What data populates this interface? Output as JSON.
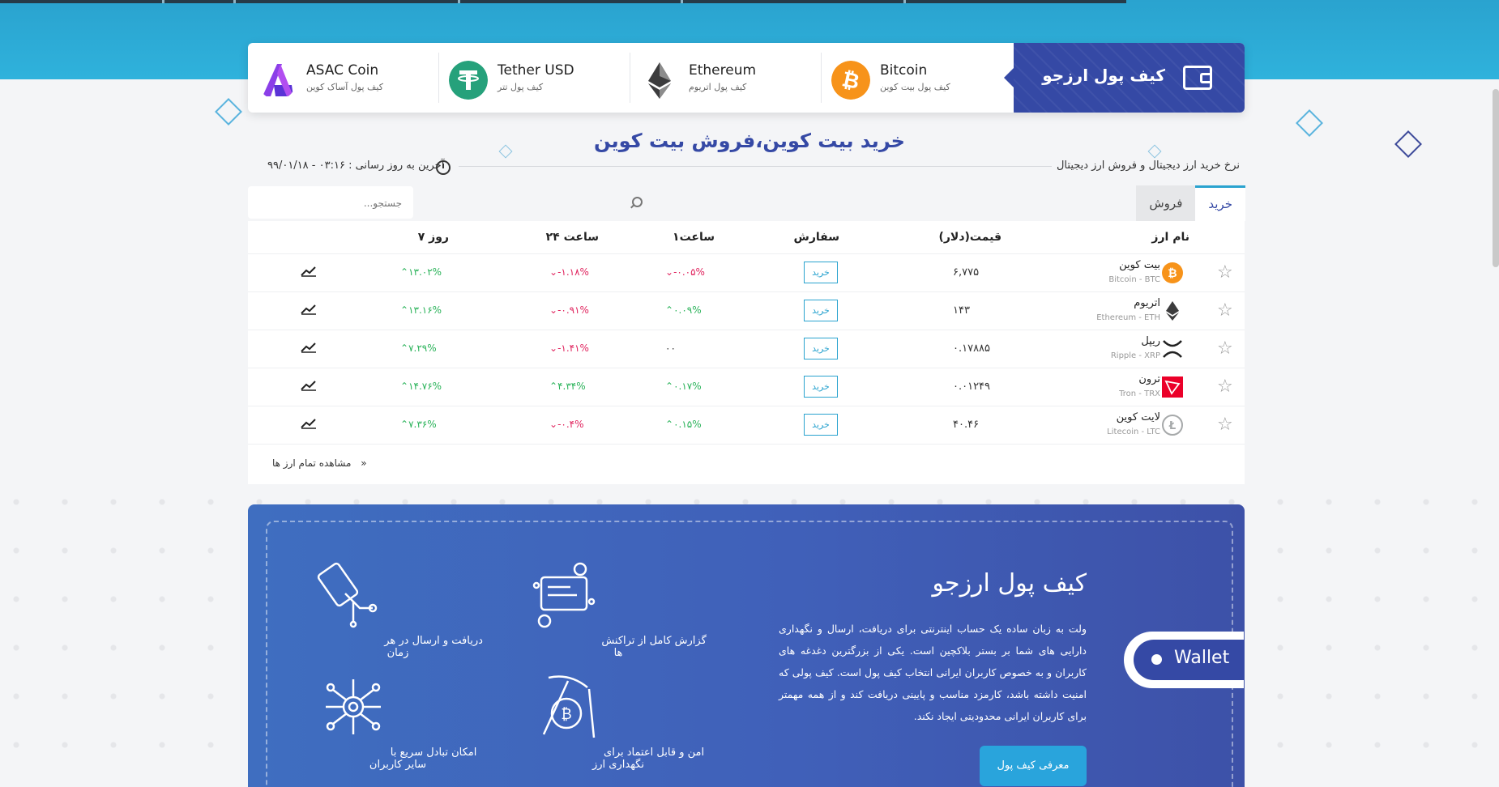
{
  "wallet_bar": {
    "title": "کیف پول ارزجو",
    "coins": [
      {
        "name": "Bitcoin",
        "sub": "کیف پول بیت کوین",
        "color": "#f7931a",
        "icon": "bitcoin-icon"
      },
      {
        "name": "Ethereum",
        "sub": "کیف پول اتریوم",
        "color": "#3c3c3d",
        "icon": "ethereum-icon"
      },
      {
        "name": "Tether USD",
        "sub": "کیف پول تتر",
        "color": "#26a17b",
        "icon": "tether-icon"
      },
      {
        "name": "ASAC Coin",
        "sub": "کیف پول آساک کوین",
        "color": "#7b3fe4",
        "icon": "asac-icon"
      }
    ]
  },
  "page_title": "خرید بیت کوین،فروش بیت کوین",
  "info": {
    "rate_label": "نرخ خرید ارز دیجیتال و فروش ارز دیجیتال",
    "updated": "آخرین به روز رسانی : ۰۳:۱۶ - ۹۹/۰۱/۱۸"
  },
  "tabs": {
    "buy": "خرید",
    "sell": "فروش"
  },
  "search": {
    "placeholder": "جستجو..."
  },
  "table": {
    "headers": {
      "name": "نام ارز",
      "price": "قیمت(دلار)",
      "order": "سفارش",
      "h1": "۱ساعت",
      "h24": "۲۴ ساعت",
      "d7": "۷ روز"
    },
    "buy_label": "خرید",
    "rows": [
      {
        "name": "بیت کوین",
        "sub": "Bitcoin - BTC",
        "price": "۶,۷۷۵",
        "h1": "-۰.۰۵%",
        "h24": "-۱.۱۸%",
        "d7": "۱۳.۰۲%",
        "h1_dir": "down",
        "h24_dir": "down",
        "d7_dir": "up",
        "icon": "bitcoin-icon",
        "color": "#f7931a"
      },
      {
        "name": "اتریوم",
        "sub": "Ethereum - ETH",
        "price": "۱۴۳",
        "h1": "۰.۰۹%",
        "h24": "-۰.۹۱%",
        "d7": "۱۳.۱۶%",
        "h1_dir": "up",
        "h24_dir": "down",
        "d7_dir": "up",
        "icon": "ethereum-icon",
        "color": "#3c3c3d"
      },
      {
        "name": "ریپل",
        "sub": "Ripple - XRP",
        "price": "۰.۱۷۸۸۵",
        "h1": "۰۰",
        "h24": "-۱.۴۱%",
        "d7": "۷.۲۹%",
        "h1_dir": "none",
        "h24_dir": "down",
        "d7_dir": "up",
        "icon": "ripple-icon",
        "color": "#222222"
      },
      {
        "name": "ترون",
        "sub": "Tron - TRX",
        "price": "۰.۰۱۲۴۹",
        "h1": "۰.۱۷%",
        "h24": "۴.۳۴%",
        "d7": "۱۴.۷۶%",
        "h1_dir": "up",
        "h24_dir": "up",
        "d7_dir": "up",
        "icon": "tron-icon",
        "color": "#eb0029"
      },
      {
        "name": "لایت کوین",
        "sub": "Litecoin - LTC",
        "price": "۴۰.۴۶",
        "h1": "۰.۱۵%",
        "h24": "-۰.۴%",
        "d7": "۷.۳۶%",
        "h1_dir": "up",
        "h24_dir": "down",
        "d7_dir": "up",
        "icon": "litecoin-icon",
        "color": "#a6a9aa"
      }
    ],
    "more_link": "مشاهده تمام ارز ها"
  },
  "promo": {
    "title": "کیف پول ارزجو",
    "text": "ولت به زبان ساده یک حساب اینترنتی برای دریافت، ارسال و نگهداری دارایی های شما بر بستر بلاکچین است. یکی از بزرگترین دغدغه های کاربران و به خصوص کاربران ایرانی انتخاب کیف پول است. کیف پولی که امنیت داشته باشد، کارمزد مناسب و پایینی دریافت کند و از همه مهمتر برای کاربران ایرانی محدودیتی ایجاد نکند.",
    "button": "معرفی کیف پول",
    "features": [
      {
        "label": "گزارش کامل از تراکنش ها",
        "icon": "transactions-report-icon"
      },
      {
        "label": "دریافت و ارسال در هر زمان",
        "icon": "card-transfer-icon"
      },
      {
        "label": "امن و قابل اعتماد برای نگهداری ارز",
        "icon": "secure-mining-icon"
      },
      {
        "label": "امکان تبادل سریع با سایر کاربران",
        "icon": "network-exchange-icon"
      }
    ],
    "pill_label": "Wallet"
  }
}
